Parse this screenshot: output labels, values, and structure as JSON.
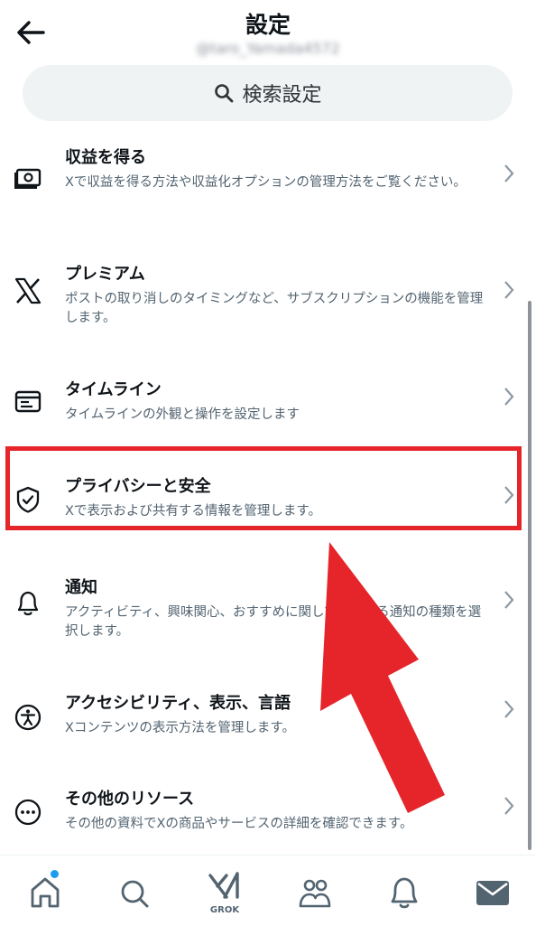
{
  "header": {
    "title": "設定",
    "handle": "@taro_Yamada4572",
    "search_placeholder": "検索設定"
  },
  "settings": [
    {
      "title": "収益を得る",
      "description": "Xで収益を得る方法や収益化オプションの管理方法をご覧ください。",
      "icon": "monetization-icon"
    },
    {
      "title": "プレミアム",
      "description": "ポストの取り消しのタイミングなど、サブスクリプションの機能を管理します。",
      "icon": "x-logo-icon"
    },
    {
      "title": "タイムライン",
      "description": "タイムラインの外観と操作を設定します",
      "icon": "timeline-icon"
    },
    {
      "title": "プライバシーと安全",
      "description": "Xで表示および共有する情報を管理します。",
      "icon": "shield-icon"
    },
    {
      "title": "通知",
      "description": "アクティビティ、興味関心、おすすめに関して受け取る通知の種類を選択します。",
      "icon": "bell-icon"
    },
    {
      "title": "アクセシビリティ、表示、言語",
      "description": "Xコンテンツの表示方法を管理します。",
      "icon": "accessibility-icon"
    },
    {
      "title": "その他のリソース",
      "description": "その他の資料でXの商品やサービスの詳細を確認できます。",
      "icon": "more-circle-icon"
    }
  ],
  "tabbar": {
    "grok_label": "GROK",
    "tabs": [
      "home-icon",
      "search-icon",
      "grok-icon",
      "communities-icon",
      "notifications-icon",
      "messages-icon"
    ]
  },
  "colors": {
    "highlight": "#e5252a",
    "text_primary": "#0f1419",
    "text_secondary": "#536471",
    "search_bg": "#eff3f4",
    "notification_dot": "#1d9bf0"
  }
}
